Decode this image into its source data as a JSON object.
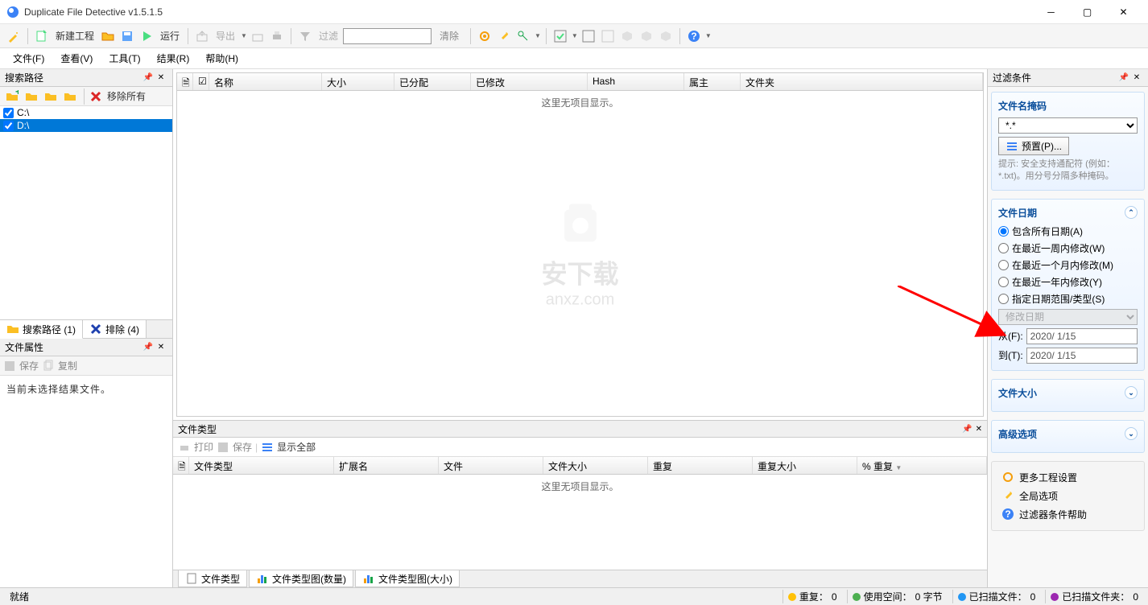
{
  "app": {
    "title": "Duplicate File Detective v1.5.1.5"
  },
  "toolbar": {
    "new_project": "新建工程",
    "run": "运行",
    "export": "导出",
    "filter_label": "过滤",
    "clear": "清除"
  },
  "menu": {
    "file": "文件(F)",
    "view": "查看(V)",
    "tools": "工具(T)",
    "results": "结果(R)",
    "help": "帮助(H)"
  },
  "left": {
    "search_path": "搜索路径",
    "remove_all": "移除所有",
    "drives": [
      "C:\\",
      "D:\\"
    ],
    "tab_search": "搜索路径 (1)",
    "tab_exclude": "排除 (4)",
    "file_props": "文件属性",
    "save": "保存",
    "copy": "复制",
    "no_selection": "当前未选择结果文件。"
  },
  "grid": {
    "cols": {
      "name": "名称",
      "size": "大小",
      "allocated": "已分配",
      "modified": "已修改",
      "hash": "Hash",
      "owner": "属主",
      "folder": "文件夹"
    },
    "empty": "这里无项目显示。"
  },
  "bottom": {
    "title": "文件类型",
    "print": "打印",
    "save": "保存",
    "show_all": "显示全部",
    "cols": {
      "type": "文件类型",
      "ext": "扩展名",
      "files": "文件",
      "size": "文件大小",
      "dup": "重复",
      "dupsize": "重复大小",
      "pct": "% 重复"
    },
    "empty": "这里无项目显示。",
    "tab1": "文件类型",
    "tab2": "文件类型图(数量)",
    "tab3": "文件类型图(大小)"
  },
  "right": {
    "header": "过滤条件",
    "mask": {
      "title": "文件名掩码",
      "value": "*.*",
      "preset": "预置(P)...",
      "hint": "提示: 安全支持通配符 (例如：*.txt)。用分号分隔多种掩码。"
    },
    "date": {
      "title": "文件日期",
      "r1": "包含所有日期(A)",
      "r2": "在最近一周内修改(W)",
      "r3": "在最近一个月内修改(M)",
      "r4": "在最近一年内修改(Y)",
      "r5": "指定日期范围/类型(S)",
      "dtype": "修改日期",
      "from_label": "从(F):",
      "to_label": "到(T):",
      "from": "2020/ 1/15",
      "to": "2020/ 1/15"
    },
    "size": {
      "title": "文件大小"
    },
    "adv": {
      "title": "高级选项"
    },
    "links": {
      "more": "更多工程设置",
      "global": "全局选项",
      "help": "过滤器条件帮助"
    }
  },
  "status": {
    "ready": "就绪",
    "dup": "重复：",
    "dup_v": "0",
    "space": "使用空间：",
    "space_v": "0 字节",
    "scanned": "已扫描文件：",
    "scanned_v": "0",
    "folders": "已扫描文件夹：",
    "folders_v": "0"
  }
}
